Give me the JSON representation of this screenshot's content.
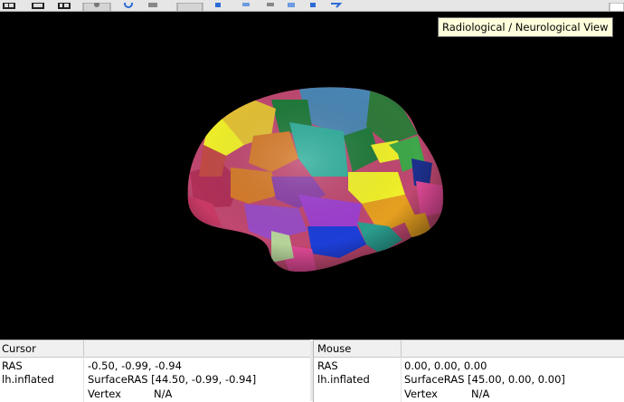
{
  "tooltip": {
    "text": "Radiological / Neurological View"
  },
  "toolbar": {
    "icons": [
      "layout-icon",
      "camera-icon",
      "view-icon",
      "settings-icon"
    ]
  },
  "viewport": {
    "background": "#000000",
    "brain_surface": "lh.inflated"
  },
  "cursor_panel": {
    "header": "Cursor",
    "rows": [
      {
        "label": "RAS",
        "value": "-0.50, -0.99, -0.94"
      },
      {
        "label": "lh.inflated",
        "value": "SurfaceRAS [44.50, -0.99, -0.94]"
      },
      {
        "label": "",
        "sub_label": "Vertex",
        "value": "N/A"
      }
    ]
  },
  "mouse_panel": {
    "header": "Mouse",
    "rows": [
      {
        "label": "RAS",
        "value": "0.00, 0.00, 0.00"
      },
      {
        "label": "lh.inflated",
        "value": "SurfaceRAS [45.00, 0.00, 0.00]"
      },
      {
        "label": "",
        "sub_label": "Vertex",
        "value": "N/A"
      }
    ]
  }
}
